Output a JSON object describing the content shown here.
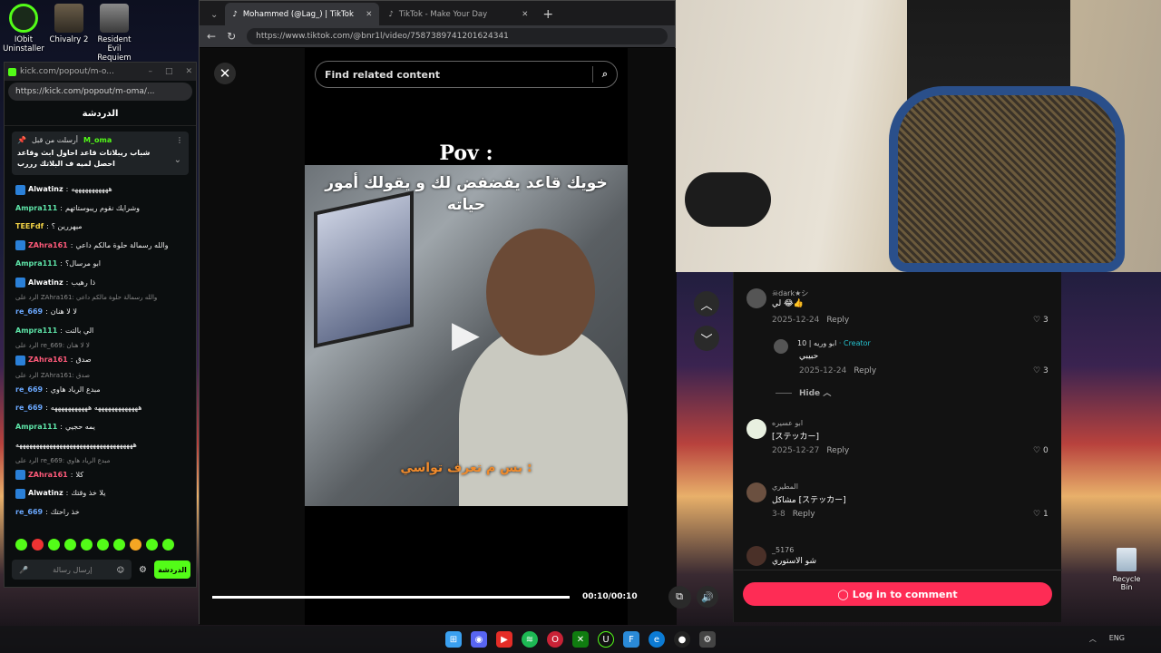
{
  "desktop": {
    "icons": [
      {
        "label": "IObit Uninstaller"
      },
      {
        "label": "Chivalry 2"
      },
      {
        "label": "Resident Evil Requiem"
      }
    ],
    "recycle_bin": "Recycle Bin"
  },
  "kick": {
    "window_title": "kick.com/popout/m-o...",
    "url": "https://kick.com/popout/m-oma/...",
    "chat_header": "الدردشة",
    "pinned": {
      "pinned_by_label": "أرسلت من قبل",
      "user": "M_oma",
      "text": "شباب ريبلاتات قاعد احاول ابث وقاعد احصل لميه ف البلاتك رررب"
    },
    "messages": [
      {
        "user": "Alwatinz",
        "color": "#fff",
        "badge": true,
        "text": "هههههههههههه",
        "reply": false
      },
      {
        "user": "Ampra111",
        "color": "#5ee5a8",
        "badge": false,
        "text": "وشرايك نقوم ريبوستاتهم",
        "reply": false
      },
      {
        "user": "TEEFdf",
        "color": "#f5d547",
        "badge": false,
        "text": "ميهررين ؟",
        "reply": false
      },
      {
        "user": "ZAhra161",
        "color": "#ff5a7a",
        "badge": true,
        "text": "والله رسمالة حلوة مالكم داعي",
        "reply": false
      },
      {
        "user": "Ampra111",
        "color": "#5ee5a8",
        "badge": false,
        "text": "ابو مرسال؟",
        "reply": false
      },
      {
        "user": "Alwatinz",
        "color": "#fff",
        "badge": true,
        "text": "ذا رهيب",
        "reply": false
      },
      {
        "user": "",
        "color": "#888",
        "badge": false,
        "text": "الرد على ZAhra161: والله رسمالة حلوة مالكم داعي",
        "reply": true
      },
      {
        "user": "re_669",
        "color": "#6aa8ff",
        "badge": false,
        "text": "لا لا هنان",
        "reply": false
      },
      {
        "user": "Ampra111",
        "color": "#5ee5a8",
        "badge": false,
        "text": "الي بالتت",
        "reply": false
      },
      {
        "user": "",
        "color": "#888",
        "badge": false,
        "text": "الرد على re_669: لا لا هنان",
        "reply": true
      },
      {
        "user": "ZAhra161",
        "color": "#ff5a7a",
        "badge": true,
        "text": "صدق",
        "reply": false
      },
      {
        "user": "",
        "color": "#888",
        "badge": false,
        "text": "الرد على ZAhra161: صدق",
        "reply": true
      },
      {
        "user": "re_669",
        "color": "#6aa8ff",
        "badge": false,
        "text": "مبدع الرياد هاوي",
        "reply": false
      },
      {
        "user": "re_669",
        "color": "#6aa8ff",
        "badge": false,
        "text": "هههههههههههههه هههههههههههه",
        "reply": false
      },
      {
        "user": "Ampra111",
        "color": "#5ee5a8",
        "badge": false,
        "text": "يمه حجيي",
        "reply": false
      },
      {
        "user": "",
        "color": "#fff",
        "badge": false,
        "text": "هههههههههههههههههههههههههههههههههههه",
        "reply": false
      },
      {
        "user": "",
        "color": "#888",
        "badge": false,
        "text": "الرد على re_669: مبدع الرياد هاوي",
        "reply": true
      },
      {
        "user": "ZAhra161",
        "color": "#ff5a7a",
        "badge": true,
        "text": "كلا",
        "reply": false
      },
      {
        "user": "Alwatinz",
        "color": "#fff",
        "badge": true,
        "text": "يلا خذ وقتك",
        "reply": false
      },
      {
        "user": "re_669",
        "color": "#6aa8ff",
        "badge": false,
        "text": "خذ راحتك",
        "reply": false
      }
    ],
    "input_placeholder": "إرسال رسالة",
    "send_label": "الدردشة"
  },
  "browser": {
    "tabs": [
      {
        "title": "Mohammed (@Lag_) | TikTok",
        "active": true
      },
      {
        "title": "TikTok - Make Your Day",
        "active": false
      }
    ],
    "url": "https://www.tiktok.com/@bnr1l/video/7587389741201624341"
  },
  "tiktok": {
    "search_placeholder": "Find related content",
    "video_title_text": "Pov :",
    "caption_top": "خويك قاعد يفضفض لك و يقولك أمور حياته",
    "caption_bottom": "بس م تعرف تواسي :",
    "time": "00:10/00:10",
    "progress": 1.0,
    "login_label": "Log in to comment"
  },
  "comments": [
    {
      "user": "☠dark★シ",
      "text": "لي 😂👍",
      "date": "2025-12-24",
      "reply": "Reply",
      "likes": "3",
      "nested": false
    },
    {
      "user": "10 | ابو وريه",
      "creator": "· Creator",
      "text": "حبيبي",
      "date": "2025-12-24",
      "reply": "Reply",
      "likes": "3",
      "nested": true
    },
    {
      "user": "ابو عسيره",
      "text": "[ステッカー]",
      "date": "2025-12-27",
      "reply": "Reply",
      "likes": "0",
      "nested": false
    },
    {
      "user": "المطيري",
      "text": "مشاكل [ステッカー]",
      "date": "3-8",
      "reply": "Reply",
      "likes": "1",
      "nested": false
    },
    {
      "user": "_5176",
      "text": "شو الاستوري",
      "date": "",
      "reply": "",
      "likes": "",
      "nested": false
    }
  ],
  "hide_label": "Hide",
  "taskbar": {
    "tray": [
      "ENG"
    ]
  }
}
